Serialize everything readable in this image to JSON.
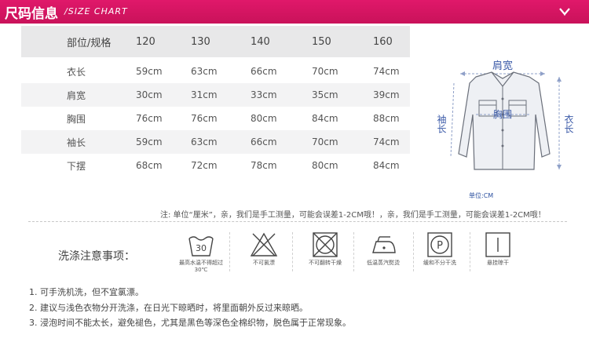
{
  "header": {
    "title": "尺码信息",
    "subtitle": "/SIZE CHART"
  },
  "table": {
    "header": [
      "部位/规格",
      "120",
      "130",
      "140",
      "150",
      "160"
    ],
    "rows": [
      [
        "衣长",
        "59cm",
        "63cm",
        "66cm",
        "70cm",
        "74cm"
      ],
      [
        "肩宽",
        "30cm",
        "31cm",
        "33cm",
        "35cm",
        "39cm"
      ],
      [
        "胸围",
        "76cm",
        "76cm",
        "80cm",
        "84cm",
        "88cm"
      ],
      [
        "袖长",
        "59cm",
        "63cm",
        "66cm",
        "70cm",
        "74cm"
      ],
      [
        "下摆",
        "68cm",
        "72cm",
        "78cm",
        "80cm",
        "84cm"
      ]
    ]
  },
  "figure": {
    "shoulder": "肩宽",
    "chest": "胸围",
    "sleeve": "袖长",
    "length": "衣长",
    "unit": "单位:CM"
  },
  "note": "注: 单位“厘米”，亲，我们是手工测量，可能会误差1-2CM哦！，亲，我们是手工测量，可能会误差1-2CM哦！",
  "wash": {
    "title": "洗涤注意事项：",
    "icons": [
      {
        "icon": "wash-30-icon",
        "symbol": "30",
        "caption": "最高水温不得超过30℃"
      },
      {
        "icon": "no-bleach-icon",
        "caption": "不可氯漂"
      },
      {
        "icon": "no-tumble-dry-icon",
        "caption": "不可翻转干燥"
      },
      {
        "icon": "iron-low-icon",
        "caption": "低温蒸汽熨烫"
      },
      {
        "icon": "dry-clean-icon",
        "symbol": "P",
        "caption": "缓和不分干洗"
      },
      {
        "icon": "hang-dry-icon",
        "caption": "悬挂晾干"
      }
    ]
  },
  "notes": [
    "1. 可手洗机洗，但不宜氯漂。",
    "2. 建议与浅色衣物分开洗涤，在日光下晾晒时，将里面朝外反过来晾晒。",
    "3. 浸泡时间不能太长，避免褪色，尤其是黑色等深色全棉织物，脱色属于正常现象。"
  ]
}
